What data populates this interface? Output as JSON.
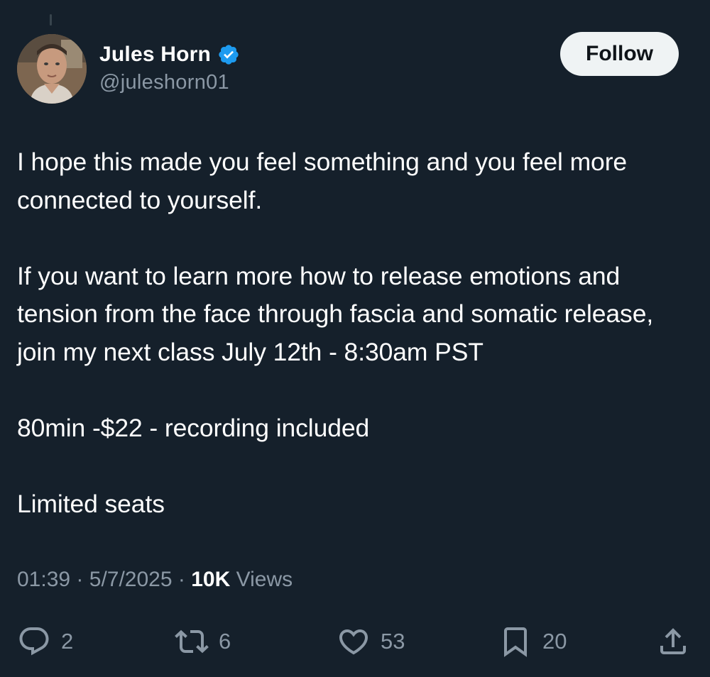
{
  "author": {
    "display_name": "Jules Horn",
    "handle": "@juleshorn01",
    "verified": true,
    "verified_color": "#1d9bf0"
  },
  "follow_button": {
    "label": "Follow"
  },
  "tweet": {
    "paragraphs": [
      "I hope this made you feel something and you feel more connected to yourself.",
      "If you want to learn more how to release emotions and tension from the face through fascia and somatic release, join my next class July 12th - 8:30am PST",
      "80min -$22 - recording included",
      "Limited seats"
    ]
  },
  "meta": {
    "time": "01:39",
    "date": "5/7/2025",
    "separator": "·",
    "views_count": "10K",
    "views_label": "Views"
  },
  "actions": {
    "replies": "2",
    "reposts": "6",
    "likes": "53",
    "bookmarks": "20"
  },
  "icons": {
    "reply": "reply-icon",
    "repost": "repost-icon",
    "like": "heart-icon",
    "bookmark": "bookmark-icon",
    "share": "share-icon"
  },
  "colors": {
    "background": "#15202b",
    "text": "#ffffff",
    "secondary_text": "#8b98a5",
    "button_bg": "#eff3f4"
  }
}
